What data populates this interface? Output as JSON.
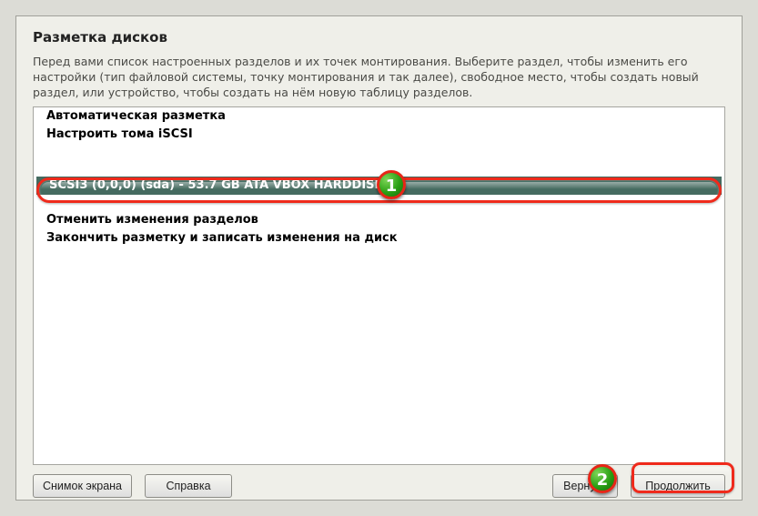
{
  "title": "Разметка дисков",
  "intro": "Перед вами список настроенных разделов и их точек монтирования. Выберите раздел, чтобы изменить его настройки (тип файловой системы, точку монтирования и так далее), свободное место, чтобы создать новый раздел, или устройство, чтобы создать на нём новую таблицу разделов.",
  "list": {
    "guided": "Автоматическая разметка",
    "iscsi": "Настроить тома iSCSI",
    "disk0": "SCSI3 (0,0,0) (sda) - 53.7 GB ATA VBOX HARDDISK",
    "undo": "Отменить изменения разделов",
    "finish": "Закончить разметку и записать изменения на диск"
  },
  "buttons": {
    "screenshot": "Снимок экрана",
    "help": "Справка",
    "back": "Вернуть",
    "continue": "Продолжить"
  },
  "annotations": {
    "badge1": "1",
    "badge2": "2"
  }
}
